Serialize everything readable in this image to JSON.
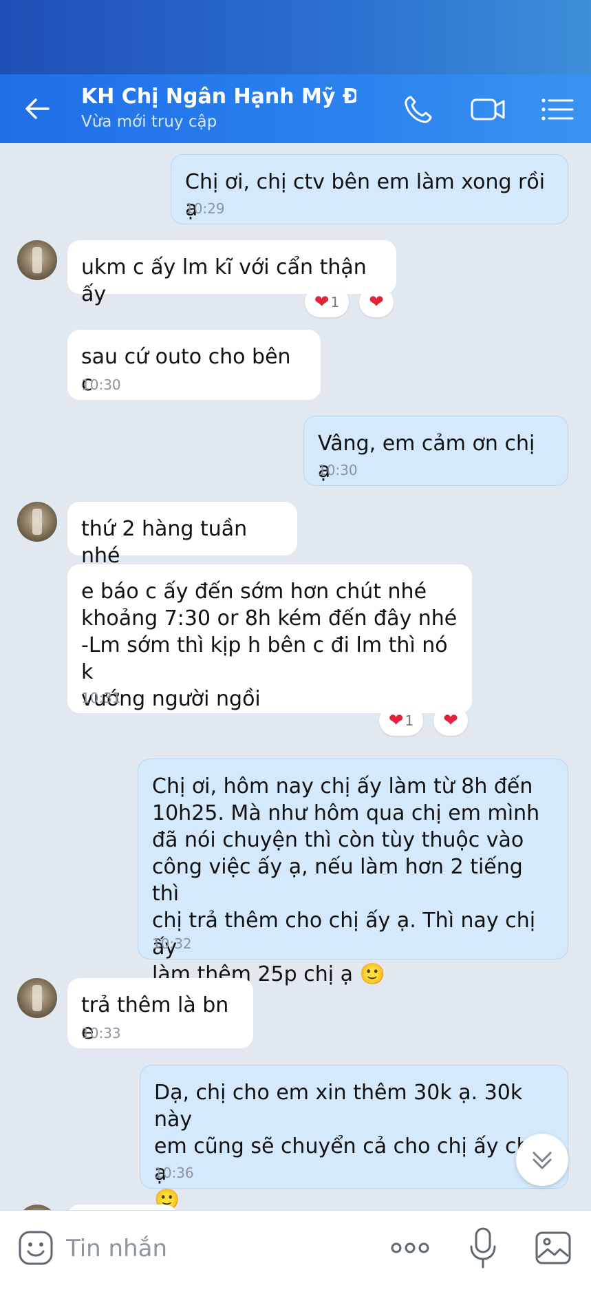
{
  "header": {
    "title": "KH Chị Ngân Hạnh Mỹ Đì...",
    "subtitle": "Vừa mới truy cập"
  },
  "messages": [
    {
      "dir": "out",
      "text": "Chị ơi, chị ctv bên em làm xong rồi ạ",
      "time": "10:29"
    },
    {
      "dir": "in",
      "text": "ukm c ấy lm kĩ với cẩn thận ấy",
      "time": "",
      "reaction_count": "1"
    },
    {
      "dir": "in",
      "text": "sau cứ outo cho bên c",
      "time": "10:30"
    },
    {
      "dir": "out",
      "text": "Vâng, em cảm ơn chị ạ",
      "time": "10:30"
    },
    {
      "dir": "in",
      "text": "thứ 2 hàng tuần nhé",
      "time": ""
    },
    {
      "dir": "in",
      "text": "e báo c ấy đến sớm hơn chút nhé\nkhoảng 7:30 or 8h kém đến đây nhé\n-Lm sớm thì kịp h bên c đi lm thì nó k\nvướng người ngồi",
      "time": "10:31",
      "reaction_count": "1"
    },
    {
      "dir": "out",
      "text": "Chị ơi, hôm nay chị ấy làm từ 8h đến\n10h25. Mà như hôm qua chị em mình\nđã nói chuyện thì còn tùy thuộc vào\ncông việc ấy ạ, nếu làm hơn 2 tiếng thì\nchị trả thêm cho chị ấy ạ. Thì nay chị ấy\nlàm thêm 25p chị ạ 🙂",
      "time": "10:32"
    },
    {
      "dir": "in",
      "text": "trả thêm là bn e",
      "time": "10:33"
    },
    {
      "dir": "out",
      "text": "Dạ, chị cho em xin thêm 30k ạ. 30k này\nem cũng sẽ chuyển cả cho chị ấy chị ạ\n🙂",
      "time": "10:36"
    }
  ],
  "composer": {
    "placeholder": "Tin nhắn"
  },
  "colors": {
    "header": "#2b82ef",
    "outgoing_bubble": "#d4e9fb",
    "incoming_bubble": "#ffffff",
    "chat_background": "#e2e8ef",
    "heart": "#e0243a"
  },
  "icons": {
    "back": "back-arrow-icon",
    "call": "phone-icon",
    "video": "video-call-icon",
    "menu": "menu-list-icon",
    "emoji": "emoji-sticker-icon",
    "more": "more-dots-icon",
    "mic": "microphone-icon",
    "image": "image-gallery-icon",
    "scroll": "chevron-double-down-icon",
    "reaction": "heart-icon"
  }
}
